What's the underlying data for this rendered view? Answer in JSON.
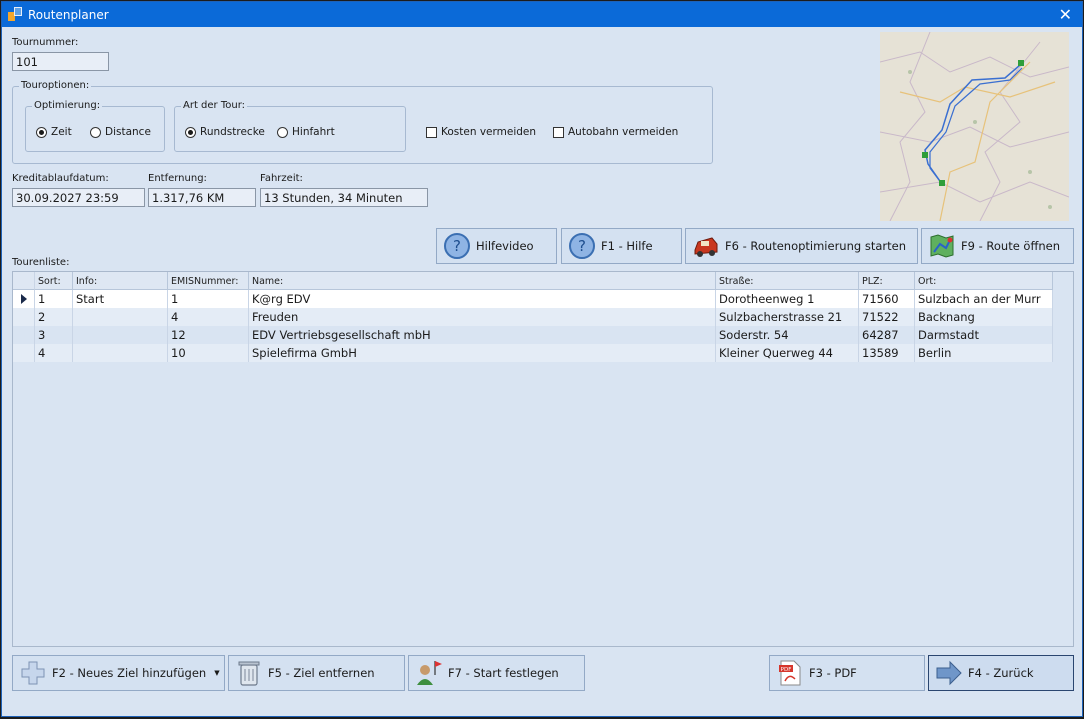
{
  "window": {
    "title": "Routenplaner",
    "close_glyph": "✕"
  },
  "tour": {
    "label": "Tournummer:",
    "value": "101"
  },
  "options": {
    "group_title": "Touroptionen:",
    "optimization": {
      "title": "Optimierung:",
      "opt1": "Zeit",
      "opt2": "Distance"
    },
    "tour_type": {
      "title": "Art der Tour:",
      "opt1": "Rundstrecke",
      "opt2": "Hinfahrt"
    },
    "avoid_costs": "Kosten vermeiden",
    "avoid_highway": "Autobahn vermeiden"
  },
  "info": {
    "credit_label": "Kreditablaufdatum:",
    "credit_value": "30.09.2027 23:59",
    "distance_label": "Entfernung:",
    "distance_value": "1.317,76 KM",
    "duration_label": "Fahrzeit:",
    "duration_value": "13 Stunden, 34 Minuten"
  },
  "toolbar": {
    "video": "Hilfevideo",
    "help": "F1 - Hilfe",
    "optimize": "F6 - Routenoptimierung starten",
    "open_route": "F9 - Route öffnen"
  },
  "list": {
    "label": "Tourenliste:",
    "columns": [
      "Sort:",
      "Info:",
      "EMISNummer:",
      "Name:",
      "Straße:",
      "PLZ:",
      "Ort:"
    ],
    "rows": [
      [
        "1",
        "Start",
        "1",
        "K@rg EDV",
        "Dorotheenweg 1",
        "71560",
        "Sulzbach an der Murr"
      ],
      [
        "2",
        "",
        "4",
        "Freuden",
        "Sulzbacherstrasse 21",
        "71522",
        "Backnang"
      ],
      [
        "3",
        "",
        "12",
        "EDV Vertriebsgesellschaft mbH",
        "Soderstr. 54",
        "64287",
        "Darmstadt"
      ],
      [
        "4",
        "",
        "10",
        "Spielefirma GmbH",
        "Kleiner Querweg 44",
        "13589",
        "Berlin"
      ]
    ]
  },
  "footer": {
    "add": "F2 - Neues Ziel hinzufügen",
    "remove": "F5 - Ziel entfernen",
    "set_start": "F7 - Start festlegen",
    "pdf": "F3 - PDF",
    "back": "F4 - Zurück"
  },
  "colors": {
    "titlebar": "#0b6ad8",
    "background": "#d9e4f2",
    "selected_row": "#ffffff",
    "alt_row": "#e4ecf6"
  }
}
